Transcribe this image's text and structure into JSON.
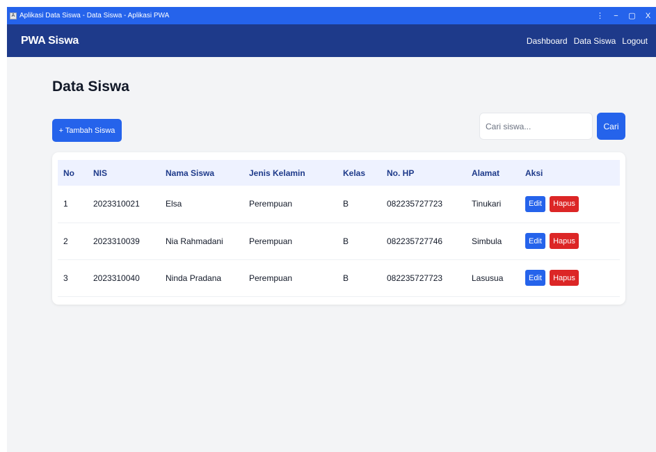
{
  "window": {
    "title": "Aplikasi Data Siswa - Data Siswa - Aplikasi PWA",
    "app_icon": "A",
    "menu_glyph": "⋮",
    "minimize_glyph": "−",
    "restore_glyph": "▢",
    "close_glyph": "X"
  },
  "navbar": {
    "brand": "PWA Siswa",
    "links": [
      "Dashboard",
      "Data Siswa",
      "Logout"
    ]
  },
  "main": {
    "title": "Data Siswa",
    "add_button": "+ Tambah Siswa",
    "search": {
      "placeholder": "Cari siswa...",
      "value": "",
      "button": "Cari"
    }
  },
  "table": {
    "headers": [
      "No",
      "NIS",
      "Nama Siswa",
      "Jenis Kelamin",
      "Kelas",
      "No. HP",
      "Alamat",
      "Aksi"
    ],
    "rows": [
      [
        "1",
        "2023310021",
        "Elsa",
        "Perempuan",
        "B",
        "082235727723",
        "Tinukari"
      ],
      [
        "2",
        "2023310039",
        "Nia Rahmadani",
        "Perempuan",
        "B",
        "082235727746",
        "Simbula"
      ],
      [
        "3",
        "2023310040",
        "Ninda Pradana",
        "Perempuan",
        "B",
        "082235727723",
        "Lasusua"
      ]
    ],
    "edit_label": "Edit",
    "delete_label": "Hapus"
  },
  "colors": {
    "titlebar": "#2563eb",
    "navbar": "#1e3a8a",
    "primary": "#2563eb",
    "danger": "#dc2626",
    "background": "#f3f4f6"
  }
}
